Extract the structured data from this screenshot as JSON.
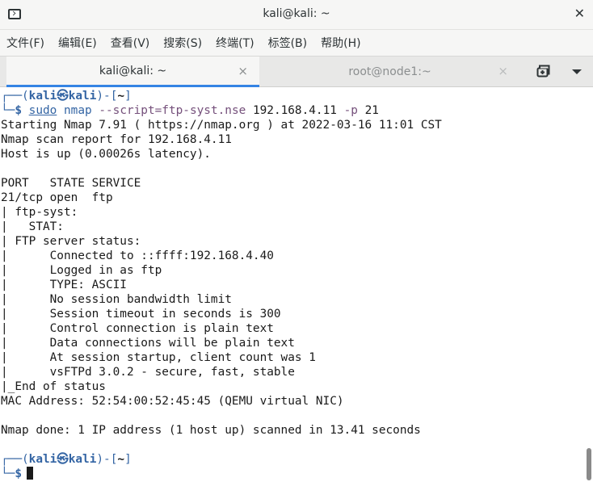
{
  "window": {
    "title": "kali@kali: ~",
    "close_glyph": "✕"
  },
  "menu": {
    "items": [
      "文件(F)",
      "编辑(E)",
      "查看(V)",
      "搜索(S)",
      "终端(T)",
      "标签(B)",
      "帮助(H)"
    ]
  },
  "tabs": [
    {
      "label": "kali@kali: ~",
      "active": true,
      "close_glyph": "×"
    },
    {
      "label": "root@node1:~",
      "active": false,
      "close_glyph": "×"
    }
  ],
  "icons": {
    "app": "terminal-icon",
    "new_tab": "new-tab-icon",
    "tab_menu": "chevron-down-icon"
  },
  "prompt": {
    "corner_top": "┌──",
    "corner_bottom": "└─",
    "open": "(",
    "user": "kali",
    "at": "㉿",
    "host": "kali",
    "close": ")-[",
    "dir": "~",
    "end": "]",
    "dollar": "$"
  },
  "command": {
    "sudo": "sudo",
    "program": "nmap",
    "script_arg": "--script=ftp-syst.nse",
    "target": "192.168.4.11",
    "port_flag": "-p",
    "port": "21"
  },
  "output": [
    "Starting Nmap 7.91 ( https://nmap.org ) at 2022-03-16 11:01 CST",
    "Nmap scan report for 192.168.4.11",
    "Host is up (0.00026s latency).",
    "",
    "PORT   STATE SERVICE",
    "21/tcp open  ftp",
    "| ftp-syst:",
    "|   STAT:",
    "| FTP server status:",
    "|      Connected to ::ffff:192.168.4.40",
    "|      Logged in as ftp",
    "|      TYPE: ASCII",
    "|      No session bandwidth limit",
    "|      Session timeout in seconds is 300",
    "|      Control connection is plain text",
    "|      Data connections will be plain text",
    "|      At session startup, client count was 1",
    "|      vsFTPd 3.0.2 - secure, fast, stable",
    "|_End of status",
    "MAC Address: 52:54:00:52:45:45 (QEMU virtual NIC)",
    "",
    "Nmap done: 1 IP address (1 host up) scanned in 13.41 seconds"
  ],
  "colors": {
    "accent": "#3584e4",
    "prompt_blue": "#3465a4",
    "arg_purple": "#75507b",
    "text": "#1a1a1a"
  }
}
